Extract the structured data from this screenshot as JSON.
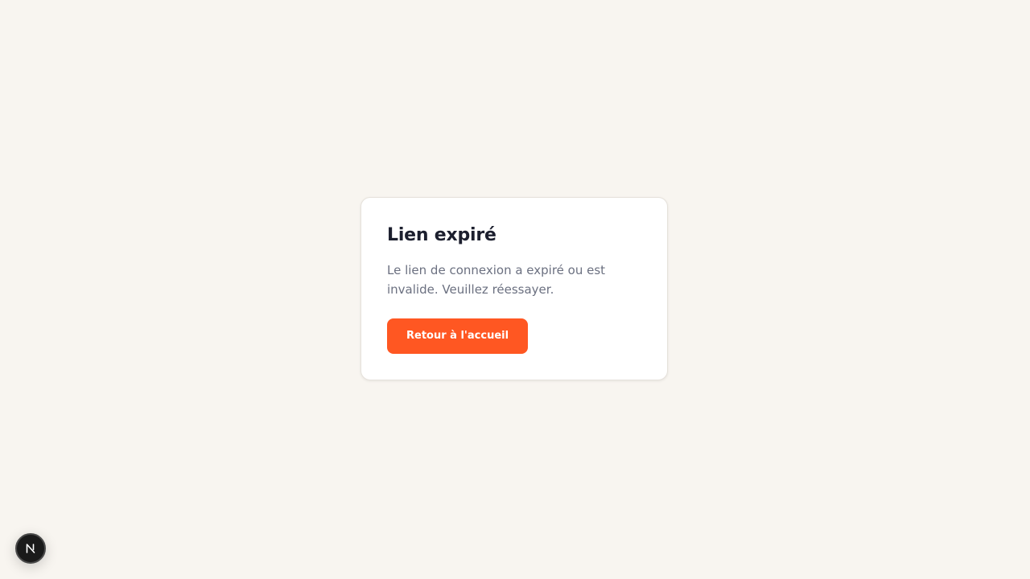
{
  "card": {
    "title": "Lien expiré",
    "message": "Le lien de connexion a expiré ou est invalide. Veuillez réessayer.",
    "button_label": "Retour à l'accueil"
  },
  "dev_badge": {
    "icon": "nextjs-logo-icon"
  },
  "colors": {
    "background": "#f8f5f0",
    "card": "#ffffff",
    "title": "#1c1f2e",
    "message": "#6b7080",
    "accent": "#ff5722",
    "badge": "#1a1a1a"
  }
}
